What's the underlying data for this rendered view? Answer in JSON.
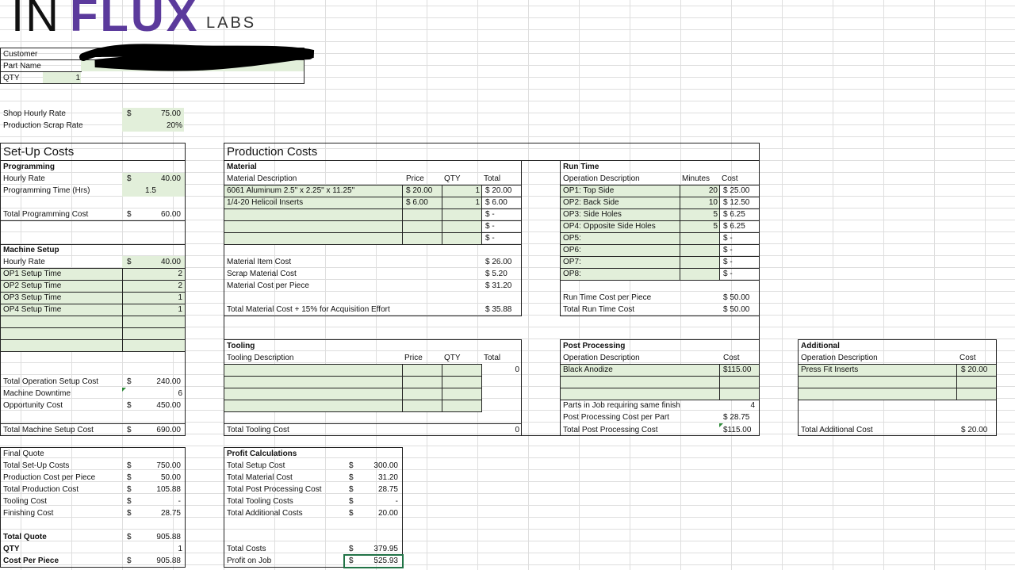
{
  "logo": {
    "in": "IN",
    "flux": "FLUX",
    "labs": "LABS"
  },
  "header": {
    "customer_label": "Customer",
    "part_name_label": "Part Name",
    "qty_label": "QTY",
    "qty_value": "1"
  },
  "rates": {
    "shop_rate_label": "Shop Hourly Rate",
    "shop_rate_cur": "$",
    "shop_rate_value": "75.00",
    "scrap_label": "Production Scrap Rate",
    "scrap_value": "20%"
  },
  "setup": {
    "title": "Set-Up Costs",
    "programming": "Programming",
    "hourly_rate_label": "Hourly Rate",
    "hourly_rate_cur": "$",
    "hourly_rate_value": "40.00",
    "prog_time_label": "Programming Time (Hrs)",
    "prog_time_value": "1.5",
    "total_prog_label": "Total Programming Cost",
    "total_prog_cur": "$",
    "total_prog_value": "60.00",
    "machine_setup": "Machine Setup",
    "ms_rate_label": "Hourly Rate",
    "ms_rate_cur": "$",
    "ms_rate_value": "40.00",
    "ops": [
      {
        "label": "OP1 Setup Time",
        "value": "2"
      },
      {
        "label": "OP2 Setup Time",
        "value": "2"
      },
      {
        "label": "OP3 Setup Time",
        "value": "1"
      },
      {
        "label": "OP4 Setup Time",
        "value": "1"
      }
    ],
    "total_op_label": "Total Operation Setup Cost",
    "total_op_cur": "$",
    "total_op_value": "240.00",
    "downtime_label": "Machine Downtime",
    "downtime_value": "6",
    "opp_label": "Opportunity Cost",
    "opp_cur": "$",
    "opp_value": "450.00",
    "total_ms_label": "Total Machine Setup Cost",
    "total_ms_cur": "$",
    "total_ms_value": "690.00"
  },
  "production": {
    "title": "Production Costs",
    "material": "Material",
    "mat_desc_h": "Material Description",
    "price_h": "Price",
    "qty_h": "QTY",
    "total_h": "Total",
    "materials": [
      {
        "desc": "6061 Aluminum 2.5\" x 2.25\" x 11.25\"",
        "price": "$ 20.00",
        "qty": "1",
        "total": "$ 20.00"
      },
      {
        "desc": "1/4-20 Helicoil Inserts",
        "price": "$ 6.00",
        "qty": "1",
        "total": "$ 6.00"
      },
      {
        "desc": "",
        "price": "",
        "qty": "",
        "total": "$ -"
      },
      {
        "desc": "",
        "price": "",
        "qty": "",
        "total": "$ -"
      },
      {
        "desc": "",
        "price": "",
        "qty": "",
        "total": "$ -"
      }
    ],
    "item_cost_label": "Material Item Cost",
    "item_cost_value": "$ 26.00",
    "scrap_cost_label": "Scrap Material Cost",
    "scrap_cost_value": "$ 5.20",
    "per_piece_label": "Material Cost per Piece",
    "per_piece_value": "$ 31.20",
    "total_mat_label": "Total Material Cost + 15% for Acquisition Effort",
    "total_mat_value": "$ 35.88",
    "tooling": "Tooling",
    "tool_desc_h": "Tooling Description",
    "tool_total_value": "0",
    "total_tool_label": "Total Tooling Cost",
    "total_tool_value": "0"
  },
  "runtime": {
    "title": "Run Time",
    "op_desc_h": "Operation Description",
    "minutes_h": "Minutes",
    "cost_h": "Cost",
    "ops": [
      {
        "desc": "OP1: Top Side",
        "min": "20",
        "cost": "$ 25.00"
      },
      {
        "desc": "OP2: Back Side",
        "min": "10",
        "cost": "$ 12.50"
      },
      {
        "desc": "OP3: Side Holes",
        "min": "5",
        "cost": "$ 6.25"
      },
      {
        "desc": "OP4: Opposite Side Holes",
        "min": "5",
        "cost": "$ 6.25"
      },
      {
        "desc": "OP5:",
        "min": "",
        "cost": "$ -"
      },
      {
        "desc": "OP6:",
        "min": "",
        "cost": "$ -"
      },
      {
        "desc": "OP7:",
        "min": "",
        "cost": "$ -"
      },
      {
        "desc": "OP8:",
        "min": "",
        "cost": "$ -"
      }
    ],
    "per_piece_label": "Run Time Cost per Piece",
    "per_piece_value": "$ 50.00",
    "total_label": "Total Run Time Cost",
    "total_value": "$ 50.00"
  },
  "post": {
    "title": "Post Processing",
    "op_desc_h": "Operation Description",
    "cost_h": "Cost",
    "item_desc": "Black Anodize",
    "item_cost": "$115.00",
    "parts_label": "Parts in Job requiring same finish",
    "parts_value": "4",
    "per_part_label": "Post Processing Cost per Part",
    "per_part_value": "$ 28.75",
    "total_label": "Total Post Processing Cost",
    "total_value": "$115.00"
  },
  "additional": {
    "title": "Additional",
    "op_desc_h": "Operation Description",
    "cost_h": "Cost",
    "item_desc": "Press Fit Inserts",
    "item_cost": "$ 20.00",
    "total_label": "Total Additional Cost",
    "total_value": "$ 20.00"
  },
  "final": {
    "title": "Final Quote",
    "rows": [
      {
        "label": "Total Set-Up Costs",
        "cur": "$",
        "value": "750.00"
      },
      {
        "label": "Production Cost per Piece",
        "cur": "$",
        "value": "50.00"
      },
      {
        "label": "Total Production Cost",
        "cur": "$",
        "value": "105.88"
      },
      {
        "label": "Tooling Cost",
        "cur": "$",
        "value": "-"
      },
      {
        "label": "Finishing Cost",
        "cur": "$",
        "value": "28.75"
      }
    ],
    "total_quote_label": "Total Quote",
    "total_quote_cur": "$",
    "total_quote_value": "905.88",
    "qty_label": "QTY",
    "qty_value": "1",
    "cpp_label": "Cost Per Piece",
    "cpp_cur": "$",
    "cpp_value": "905.88"
  },
  "profit": {
    "title": "Profit Calculations",
    "rows": [
      {
        "label": "Total Setup Cost",
        "cur": "$",
        "value": "300.00"
      },
      {
        "label": "Total Material Cost",
        "cur": "$",
        "value": "31.20"
      },
      {
        "label": "Total Post Processing Cost",
        "cur": "$",
        "value": "28.75"
      },
      {
        "label": "Total Tooling Costs",
        "cur": "$",
        "value": "-"
      },
      {
        "label": "Total Additional Costs",
        "cur": "$",
        "value": "20.00"
      }
    ],
    "total_costs_label": "Total Costs",
    "total_costs_cur": "$",
    "total_costs_value": "379.95",
    "profit_label": "Profit on Job",
    "profit_cur": "$",
    "profit_value": "525.93"
  },
  "colors": {
    "input_fill": "#e2efda",
    "brand_purple": "#5b3a9c",
    "selection": "#217346"
  }
}
